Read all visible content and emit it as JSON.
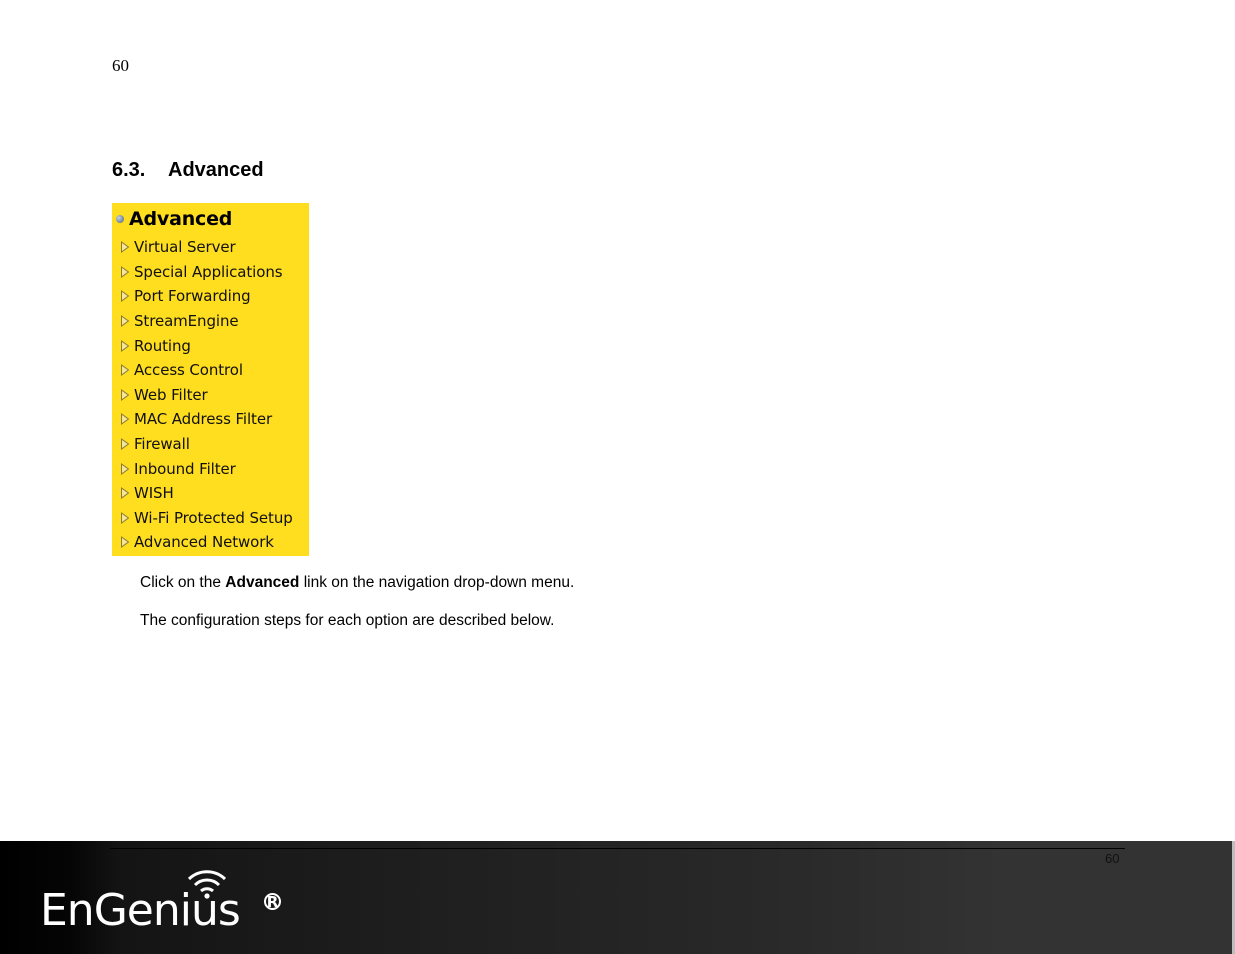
{
  "page": {
    "page_number_top": "60",
    "section_number": "6.3.",
    "section_title": "Advanced"
  },
  "menu": {
    "title": "Advanced",
    "header_icon": "bullet-icon",
    "item_icon": "triangle-right-icon",
    "background_color": "#ffdd1f",
    "items": [
      {
        "label": "Virtual Server"
      },
      {
        "label": "Special Applications"
      },
      {
        "label": "Port Forwarding"
      },
      {
        "label": "StreamEngine"
      },
      {
        "label": "Routing"
      },
      {
        "label": "Access Control"
      },
      {
        "label": "Web Filter"
      },
      {
        "label": "MAC Address Filter"
      },
      {
        "label": "Firewall"
      },
      {
        "label": "Inbound Filter"
      },
      {
        "label": "WISH"
      },
      {
        "label": "Wi-Fi Protected Setup"
      },
      {
        "label": "Advanced Network"
      }
    ]
  },
  "body": {
    "para1_before": "Click on the ",
    "para1_bold": "Advanced",
    "para1_after": " link on the navigation drop-down menu.",
    "para2": "The configuration steps for each option are described below."
  },
  "footer": {
    "page_number": "60",
    "logo_text": "EnGenius",
    "logo_reg": "R"
  }
}
